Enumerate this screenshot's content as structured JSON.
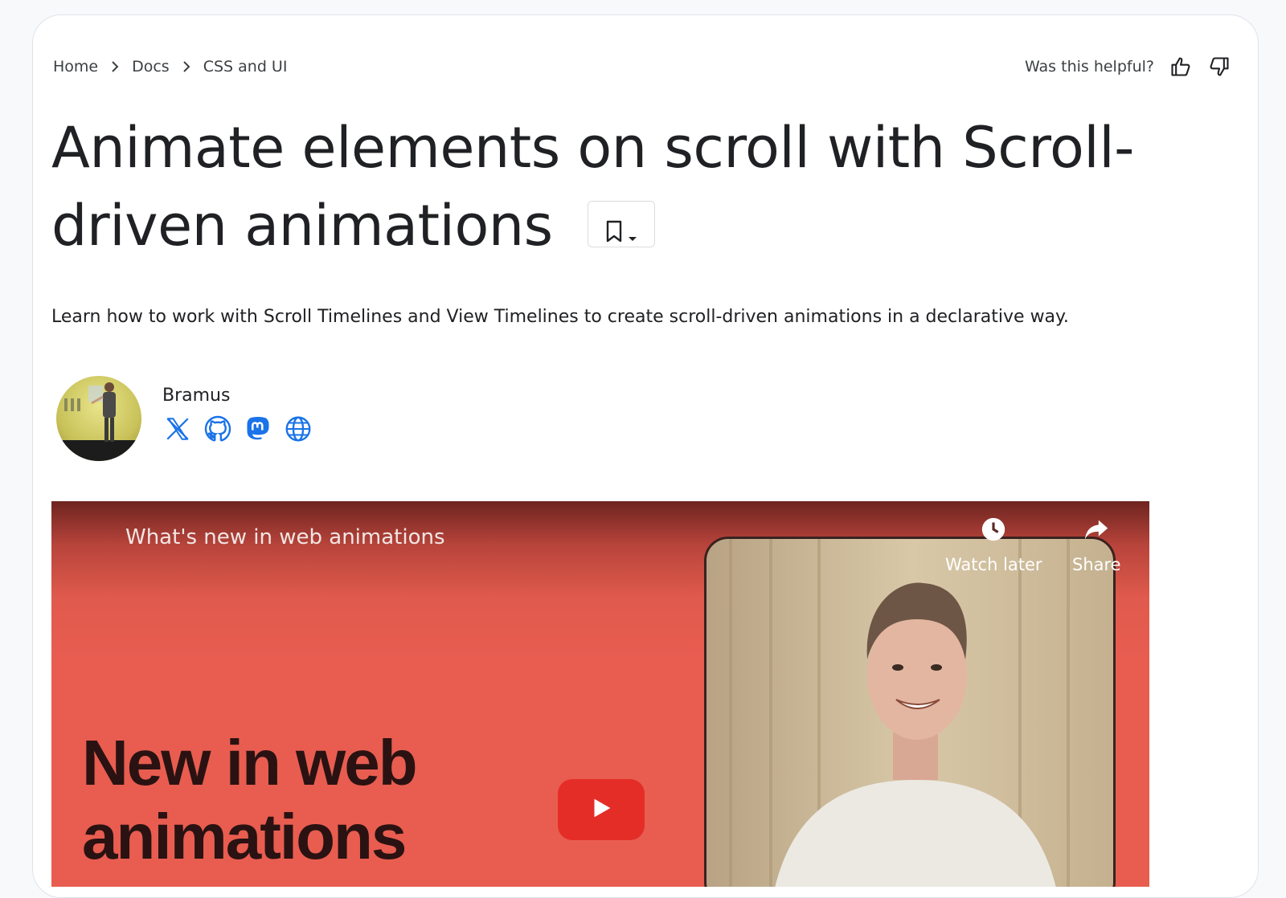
{
  "breadcrumb": {
    "items": [
      "Home",
      "Docs",
      "CSS and UI"
    ]
  },
  "feedback": {
    "question": "Was this helpful?"
  },
  "article": {
    "title": "Animate elements on scroll with Scroll-driven animations",
    "description": "Learn how to work with Scroll Timelines and View Timelines to create scroll-driven animations in a declarative way."
  },
  "author": {
    "name": "Bramus",
    "social_icons": [
      "x-icon",
      "github-icon",
      "mastodon-icon",
      "globe-icon"
    ]
  },
  "video": {
    "title": "What's new in web animations",
    "overlay_text": "New in web animations",
    "watch_later_label": "Watch later",
    "share_label": "Share"
  },
  "colors": {
    "link_blue": "#1a73e8",
    "video_red": "#e85d50",
    "play_red": "#e52d27"
  }
}
